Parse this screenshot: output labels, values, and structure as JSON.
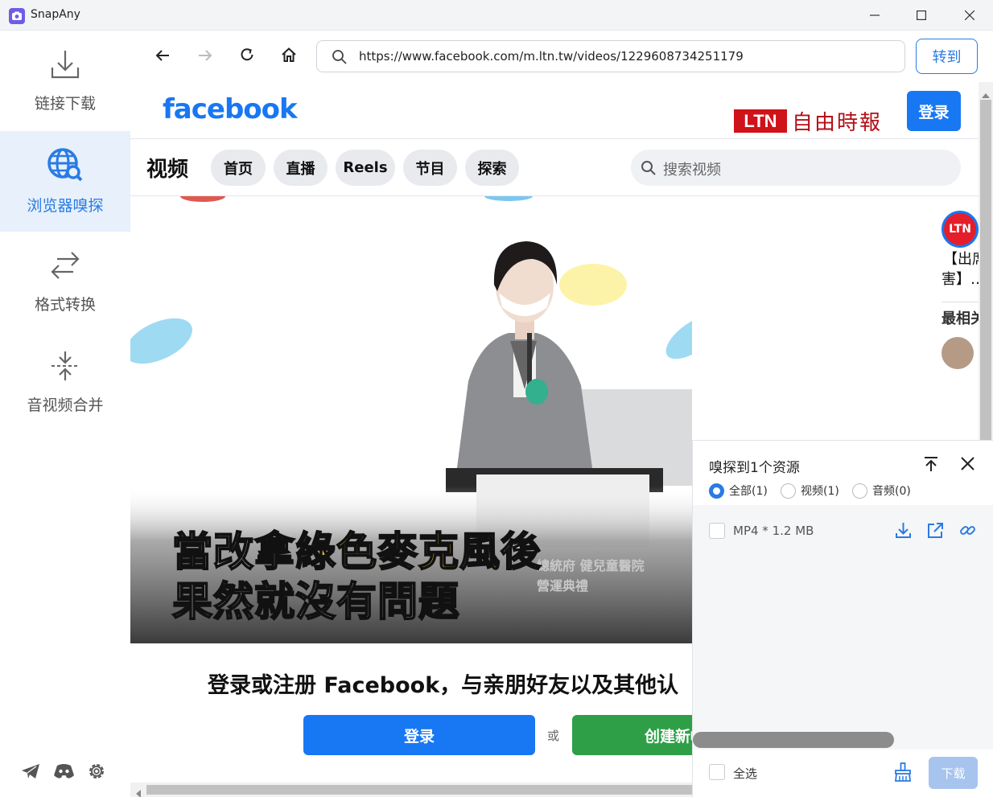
{
  "window": {
    "title": "SnapAny"
  },
  "sidebar": {
    "items": [
      {
        "label": "链接下载",
        "icon": "download-icon",
        "active": false
      },
      {
        "label": "浏览器嗅探",
        "icon": "globe-search-icon",
        "active": true
      },
      {
        "label": "格式转换",
        "icon": "swap-arrows-icon",
        "active": false
      },
      {
        "label": "音视频合并",
        "icon": "merge-icon",
        "active": false
      }
    ],
    "bottom_icons": [
      "telegram-icon",
      "discord-icon",
      "settings-icon"
    ]
  },
  "toolbar": {
    "url": "https://www.facebook.com/m.ltn.tw/videos/1229608734251179",
    "go_label": "转到"
  },
  "page": {
    "logo": "facebook",
    "login_top": "登录",
    "section_title": "视频",
    "tabs": [
      "首页",
      "直播",
      "Reels",
      "节目",
      "探索"
    ],
    "search_placeholder": "搜索视频",
    "video": {
      "channel_logo": "LTN",
      "channel_name": "自由時報",
      "subtitle_line1_a": "當改拿",
      "subtitle_line1_b": "綠色麥克風",
      "subtitle_line1_c": "後",
      "subtitle_line2": "果然就沒有問題"
    },
    "side": {
      "badge": "LTN",
      "text1": "【出席",
      "text2": "害】…",
      "heading": "最相关"
    },
    "cta_text": "登录或注册 Facebook，与亲朋好友以及其他认",
    "cta_login": "登录",
    "cta_or": "或",
    "cta_create": "创建新帐户"
  },
  "sniff": {
    "title": "嗅探到1个资源",
    "filters": [
      {
        "label": "全部(1)",
        "selected": true
      },
      {
        "label": "视频(1)",
        "selected": false
      },
      {
        "label": "音频(0)",
        "selected": false
      }
    ],
    "resource": {
      "label": "MP4 * 1.2 MB"
    },
    "select_all": "全选",
    "download": "下载"
  },
  "colors": {
    "accent": "#2a7be4",
    "facebook_blue": "#1877f2",
    "create_green": "#2e9f47",
    "channel_red": "#d0121b"
  }
}
